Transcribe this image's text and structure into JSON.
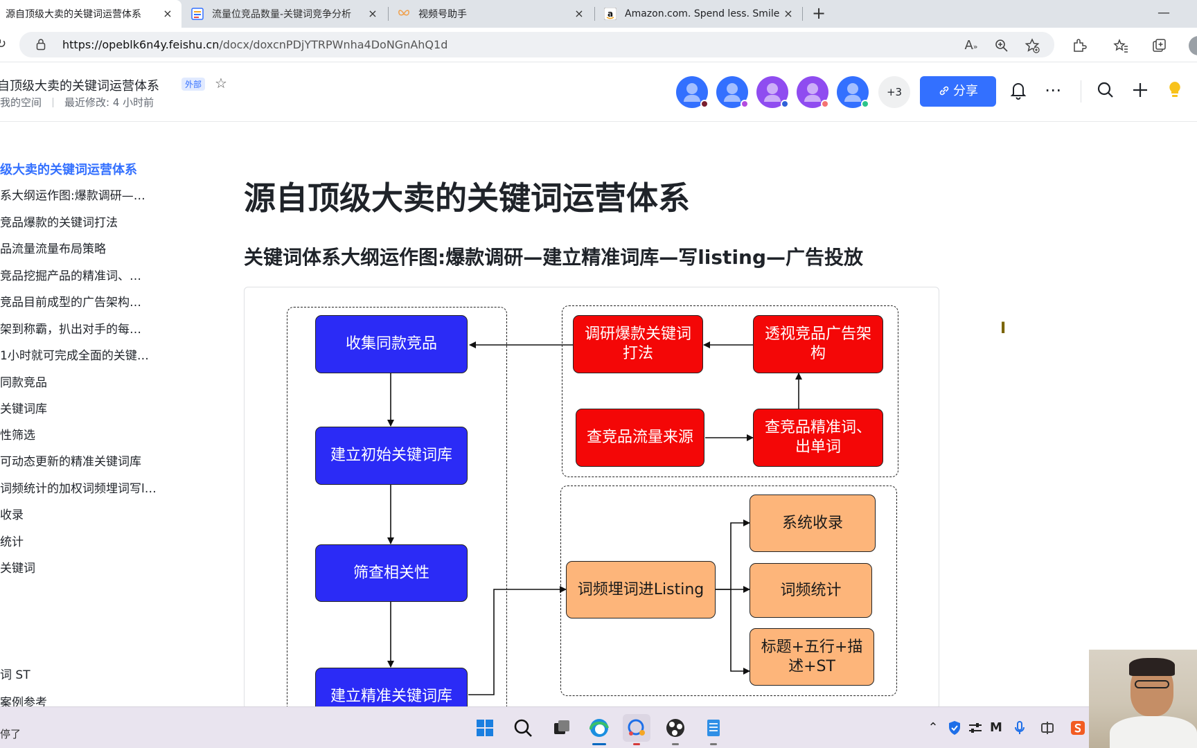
{
  "browser": {
    "tabs": [
      {
        "title": "源自顶级大卖的关键词运营体系",
        "active": true
      },
      {
        "title": "流量位竞品数量-关键词竞争分析",
        "active": false
      },
      {
        "title": "视频号助手",
        "active": false
      },
      {
        "title": "Amazon.com. Spend less. Smile more.",
        "active": false
      }
    ],
    "tab_close_glyph": "×",
    "new_tab_glyph": "+",
    "minimize_glyph": "—",
    "url_host": "https://opeblk6n4y.feishu.cn",
    "url_path": "/docx/doxcnPDjYTRPWnha4DoNGnAhQ1d"
  },
  "doc_header": {
    "title": "自顶级大卖的关键词运营体系",
    "badge": "外部",
    "breadcrumb_space": "我的空间",
    "last_modified": "最近修改: 4 小时前",
    "more_count": "+3",
    "share_label": "分享",
    "avatar_colors": [
      "#3370ff",
      "#3370ff",
      "#8f4cf0",
      "#8f4cf0",
      "#3370ff"
    ],
    "avatar_dot_colors": [
      "#7a1f2f",
      "#b24be0",
      "#2f60d8",
      "#f47272",
      "#2bc48a"
    ]
  },
  "outline": {
    "items": [
      {
        "label": "级大卖的关键词运营体系",
        "active": true
      },
      {
        "label": "系大纲运作图:爆款调研—…",
        "active": false
      },
      {
        "label": "竞品爆款的关键词打法",
        "active": false
      },
      {
        "label": "品流量流量布局策略",
        "active": false
      },
      {
        "label": "竞品挖掘产品的精准词、…",
        "active": false
      },
      {
        "label": "竞品目前成型的广告架构…",
        "active": false
      },
      {
        "label": "架到称霸，扒出对手的每…",
        "active": false
      },
      {
        "label": "1小时就可完成全面的关键…",
        "active": false
      },
      {
        "label": "同款竞品",
        "active": false
      },
      {
        "label": "关键词库",
        "active": false
      },
      {
        "label": "性筛选",
        "active": false
      },
      {
        "label": "可动态更新的精准关键词库",
        "active": false
      },
      {
        "label": "词频统计的加权词频埋词写l…",
        "active": false
      },
      {
        "label": "收录",
        "active": false
      },
      {
        "label": "统计",
        "active": false
      },
      {
        "label": "关键词",
        "active": false
      },
      {
        "label": "",
        "active": false
      },
      {
        "label": "",
        "active": false
      },
      {
        "label": "",
        "active": false
      },
      {
        "label": "词 ST",
        "active": false
      },
      {
        "label": "案例参考",
        "active": false
      }
    ]
  },
  "content": {
    "h1": "源自顶级大卖的关键词运营体系",
    "h2": "关键词体系大纲运作图:爆款调研—建立精准词库—写listing—广告投放"
  },
  "diagram": {
    "colors": {
      "blue": "#2b2bf6",
      "red": "#f40707",
      "orange": "#fdb57a"
    },
    "nodes": {
      "collect": "收集同款竞品",
      "init_lib": "建立初始关键词库",
      "screen": "筛查相关性",
      "precise_lib": "建立精准关键词库",
      "research": "调研爆款关键词打法",
      "ad_arch": "透视竞品广告架构",
      "traffic": "查竞品流量来源",
      "precise_words": "查竞品精准词、出单词",
      "listing": "词频埋词进Listing",
      "index": "系统收录",
      "freq": "词频统计",
      "title": "标题+五行+描述+ST"
    }
  },
  "taskbar": {
    "left_text": "停了"
  }
}
